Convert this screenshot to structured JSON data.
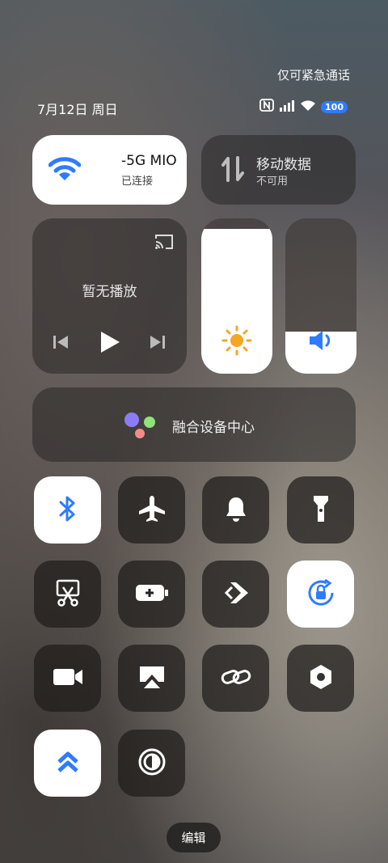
{
  "status": {
    "emergency_text": "仅可紧急通话",
    "date_text": "7月12日 周日",
    "battery_level": "100",
    "icons": [
      "nfc-icon",
      "signal-icon",
      "wifi-icon",
      "battery-icon"
    ]
  },
  "wifi_tile": {
    "network_name": "-5G      MIO",
    "status": "已连接",
    "icon": "wifi-icon",
    "accent": "#2f7bff"
  },
  "mobile_tile": {
    "title": "移动数据",
    "status": "不可用",
    "icon": "data-transfer-icon"
  },
  "media": {
    "title": "暂无播放",
    "icons": [
      "cast-icon",
      "previous-icon",
      "play-icon",
      "next-icon"
    ]
  },
  "brightness": {
    "level": 0.93,
    "icon": "sun-icon",
    "color": "#f5a623"
  },
  "volume": {
    "level": 0.27,
    "icon": "speaker-icon",
    "color": "#2f7bff"
  },
  "hub": {
    "label": "融合设备中心",
    "icon": "device-hub-icon"
  },
  "toggles": [
    {
      "name": "bluetooth",
      "icon": "bluetooth-icon",
      "active": true
    },
    {
      "name": "airplane",
      "icon": "airplane-icon",
      "active": false
    },
    {
      "name": "ringer",
      "icon": "bell-icon",
      "active": false
    },
    {
      "name": "flashlight",
      "icon": "flashlight-icon",
      "active": false
    },
    {
      "name": "screenshot",
      "icon": "scissors-icon",
      "active": false
    },
    {
      "name": "battery-saver",
      "icon": "battery-plus-icon",
      "active": false
    },
    {
      "name": "nearby-share",
      "icon": "share-diamond-icon",
      "active": false
    },
    {
      "name": "rotation-lock",
      "icon": "rotation-lock-icon",
      "active": true
    },
    {
      "name": "screen-record",
      "icon": "video-icon",
      "active": false
    },
    {
      "name": "screen-cast",
      "icon": "airplay-icon",
      "active": false
    },
    {
      "name": "link",
      "icon": "link-icon",
      "active": false
    },
    {
      "name": "settings-hex",
      "icon": "hex-nut-icon",
      "active": false
    },
    {
      "name": "performance",
      "icon": "double-chevron-up-icon",
      "active": true
    },
    {
      "name": "dark-mode",
      "icon": "contrast-icon",
      "active": false
    }
  ],
  "edit_label": "编辑"
}
